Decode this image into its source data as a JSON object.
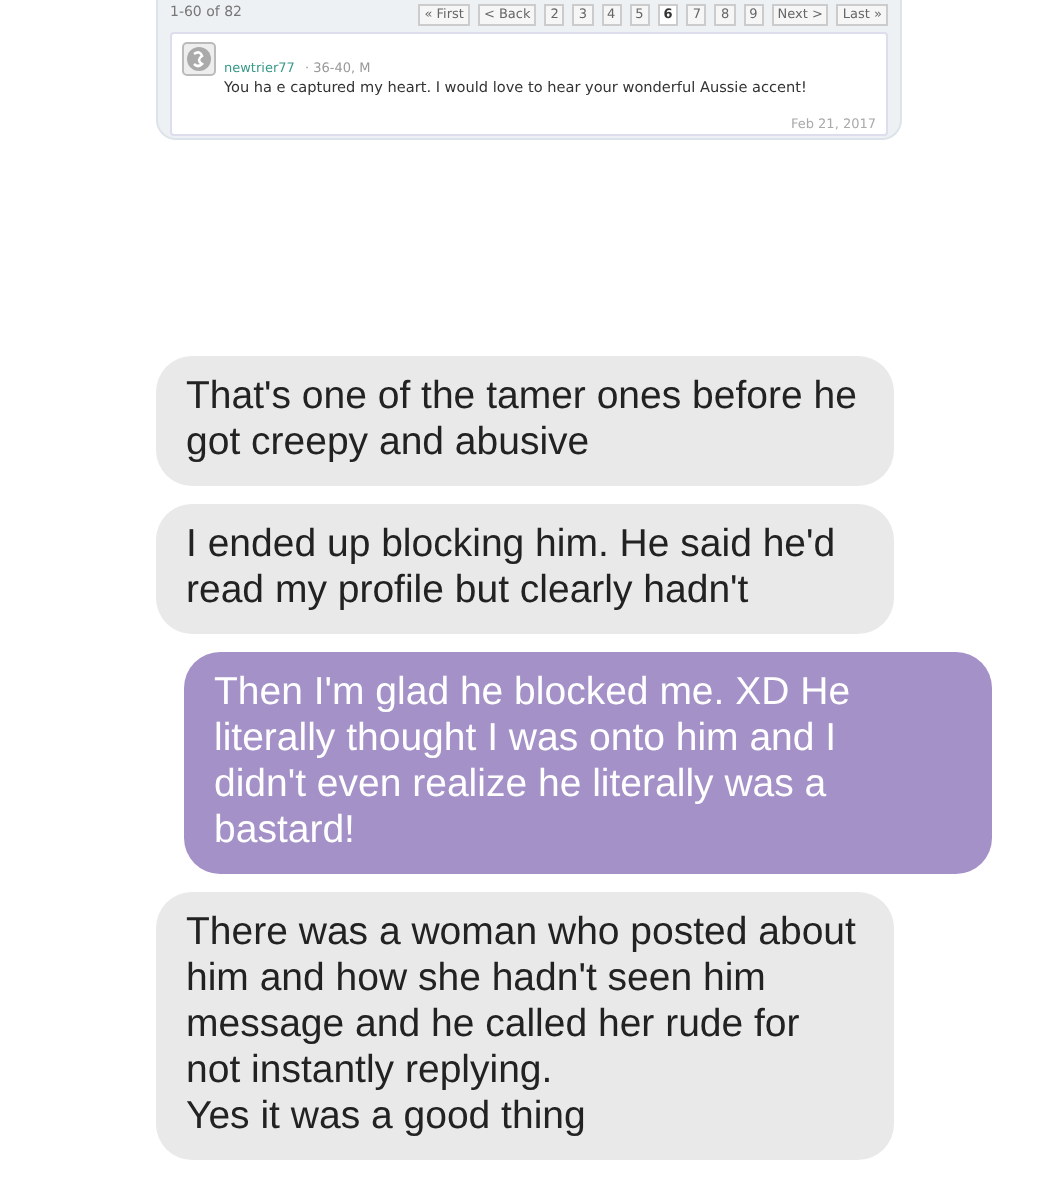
{
  "embedded_screenshot": {
    "range": "1-60 of 82",
    "pager": [
      {
        "label": "« First",
        "selected": false
      },
      {
        "label": "< Back",
        "selected": false
      },
      {
        "label": "2",
        "selected": false
      },
      {
        "label": "3",
        "selected": false
      },
      {
        "label": "4",
        "selected": false
      },
      {
        "label": "5",
        "selected": false
      },
      {
        "label": "6",
        "selected": true
      },
      {
        "label": "7",
        "selected": false
      },
      {
        "label": "8",
        "selected": false
      },
      {
        "label": "9",
        "selected": false
      },
      {
        "label": "Next >",
        "selected": false
      },
      {
        "label": "Last »",
        "selected": false
      }
    ],
    "message": {
      "username": "newtrier77",
      "meta": "· 36-40, M",
      "text": "You ha e captured my heart. I would love to hear your wonderful Aussie accent!",
      "date": "Feb 21, 2017"
    }
  },
  "messages": [
    {
      "kind": "received",
      "text": "That's one of the tamer ones before he got creepy and abusive"
    },
    {
      "kind": "received",
      "text": "I ended up blocking him. He said he'd read my profile but clearly hadn't"
    },
    {
      "kind": "sent",
      "text": "Then I'm glad he blocked me. XD He literally thought I was onto him and I didn't even realize he literally was a bastard!"
    },
    {
      "kind": "received",
      "text": "There was a woman who posted about him and how she hadn't seen him message and he called her rude for not instantly replying.\nYes it was a good thing"
    }
  ]
}
